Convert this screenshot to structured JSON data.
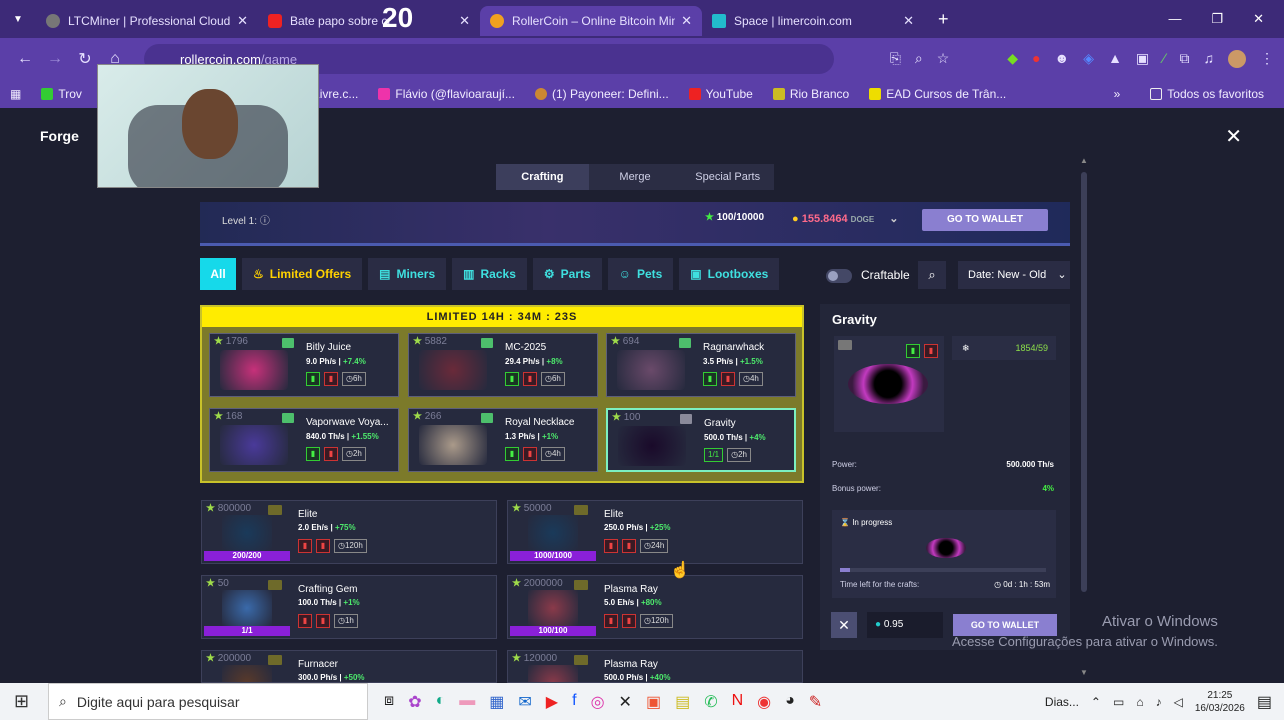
{
  "tabs": [
    {
      "title": "LTCMiner | Professional Cloud M",
      "color": "#777"
    },
    {
      "title": "Bate papo sobre cr",
      "color": "#e22"
    },
    {
      "title": "RollerCoin – Online Bitcoin Min",
      "color": "#f0a020"
    },
    {
      "title": "Space | limercoin.com",
      "color": "#2bc"
    }
  ],
  "overlay_badge": "20",
  "url": {
    "host": "rollercoin.com",
    "path": "/game"
  },
  "bookmarks": [
    "Trov",
    "| MercadoLivre.c...",
    "Flávio (@flavioaraují...",
    "(1) Payoneer: Defini...",
    "YouTube",
    "Rio Branco",
    "EAD Cursos de Trân..."
  ],
  "bookmarks_all": "Todos os favoritos",
  "forge_title": "Forge",
  "main_tabs": [
    "Crafting",
    "Merge",
    "Special Parts"
  ],
  "level": {
    "label": "Level 1:",
    "xp": "100/10000",
    "balance": "155.8464",
    "currency": "DOGE",
    "wallet_btn": "GO TO WALLET"
  },
  "filters": [
    "All",
    "Limited Offers",
    "Miners",
    "Racks",
    "Parts",
    "Pets",
    "Lootboxes"
  ],
  "craftable_label": "Craftable",
  "sort_label": "Date: New - Old",
  "limited": {
    "header": "LIMITED 14H : 34M : 23S",
    "items": [
      {
        "count": "1796",
        "name": "Bitly Juice",
        "power": "9.0 Ph/s |",
        "bonus": "+7.4%",
        "time": "6h"
      },
      {
        "count": "5882",
        "name": "MC-2025",
        "power": "29.4 Ph/s |",
        "bonus": "+8%",
        "time": "6h"
      },
      {
        "count": "694",
        "name": "Ragnarwhack",
        "power": "3.5 Ph/s |",
        "bonus": "+1.5%",
        "time": "4h"
      },
      {
        "count": "168",
        "name": "Vaporwave Voya...",
        "power": "840.0 Th/s |",
        "bonus": "+1.55%",
        "time": "2h"
      },
      {
        "count": "266",
        "name": "Royal Necklace",
        "power": "1.3 Ph/s |",
        "bonus": "+1%",
        "time": "4h"
      },
      {
        "count": "100",
        "name": "Gravity",
        "power": "500.0 Th/s |",
        "bonus": "+4%",
        "time": "2h",
        "owned": "1/1"
      }
    ]
  },
  "merge_items": [
    {
      "count": "800000",
      "name": "Elite",
      "power": "2.0 Eh/s |",
      "bonus": "+75%",
      "progress": "200/200",
      "time": "120h"
    },
    {
      "count": "50000",
      "name": "Elite",
      "power": "250.0 Ph/s |",
      "bonus": "+25%",
      "progress": "1000/1000",
      "time": "24h"
    },
    {
      "count": "50",
      "name": "Crafting Gem",
      "power": "100.0 Th/s |",
      "bonus": "+1%",
      "progress": "1/1",
      "time": "1h"
    },
    {
      "count": "2000000",
      "name": "Plasma Ray",
      "power": "5.0 Eh/s |",
      "bonus": "+80%",
      "progress": "100/100",
      "time": "120h"
    },
    {
      "count": "200000",
      "name": "Furnacer",
      "power": "300.0 Ph/s |",
      "bonus": "+50%",
      "progress": "",
      "time": ""
    },
    {
      "count": "120000",
      "name": "Plasma Ray",
      "power": "500.0 Ph/s |",
      "bonus": "+40%",
      "progress": "",
      "time": ""
    }
  ],
  "detail": {
    "title": "Gravity",
    "count": "1854/59",
    "power_label": "Power:",
    "power_value": "500.000 Th/s",
    "bonus_label": "Bonus power:",
    "bonus_value": "4%",
    "in_progress": "In progress",
    "time_left_label": "Time left for the crafts:",
    "time_left": "0d : 1h : 53m",
    "qty": "0.95",
    "wallet_btn": "GO TO WALLET"
  },
  "activate_windows": [
    "Ativar o Windows",
    "Acesse Configurações para ativar o Windows."
  ],
  "taskbar": {
    "search_placeholder": "Digite aqui para pesquisar",
    "tray_text": "Dias...",
    "time": "21:25",
    "date": "16/03/2026"
  }
}
